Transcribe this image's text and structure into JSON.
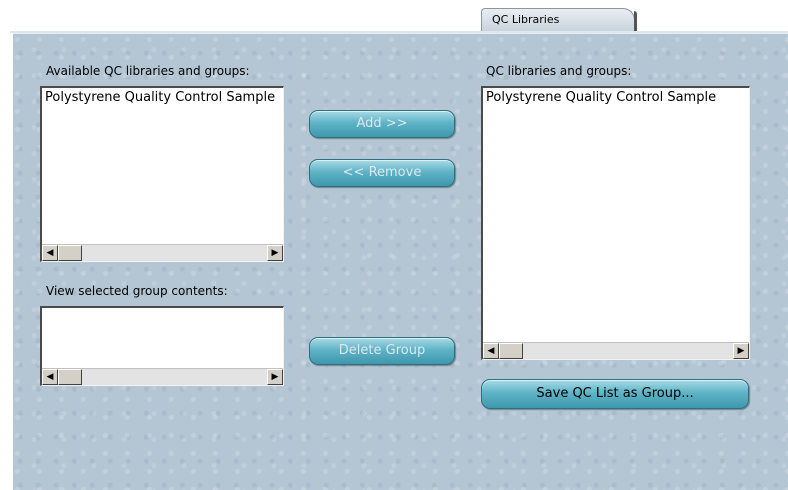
{
  "tab": {
    "label": "QC Libraries"
  },
  "available": {
    "label": "Available QC libraries and groups:",
    "items": [
      "Polystyrene Quality Control Sample"
    ]
  },
  "selected": {
    "label": "QC libraries and groups:",
    "items": [
      "Polystyrene Quality Control Sample"
    ]
  },
  "group_contents": {
    "label": "View selected group contents:",
    "items": []
  },
  "buttons": {
    "add": "Add >>",
    "remove": "<< Remove",
    "delete_group": "Delete Group",
    "save_group": "Save QC List as Group..."
  },
  "scrollbar": {
    "left_arrow": "◀",
    "right_arrow": "▶"
  }
}
